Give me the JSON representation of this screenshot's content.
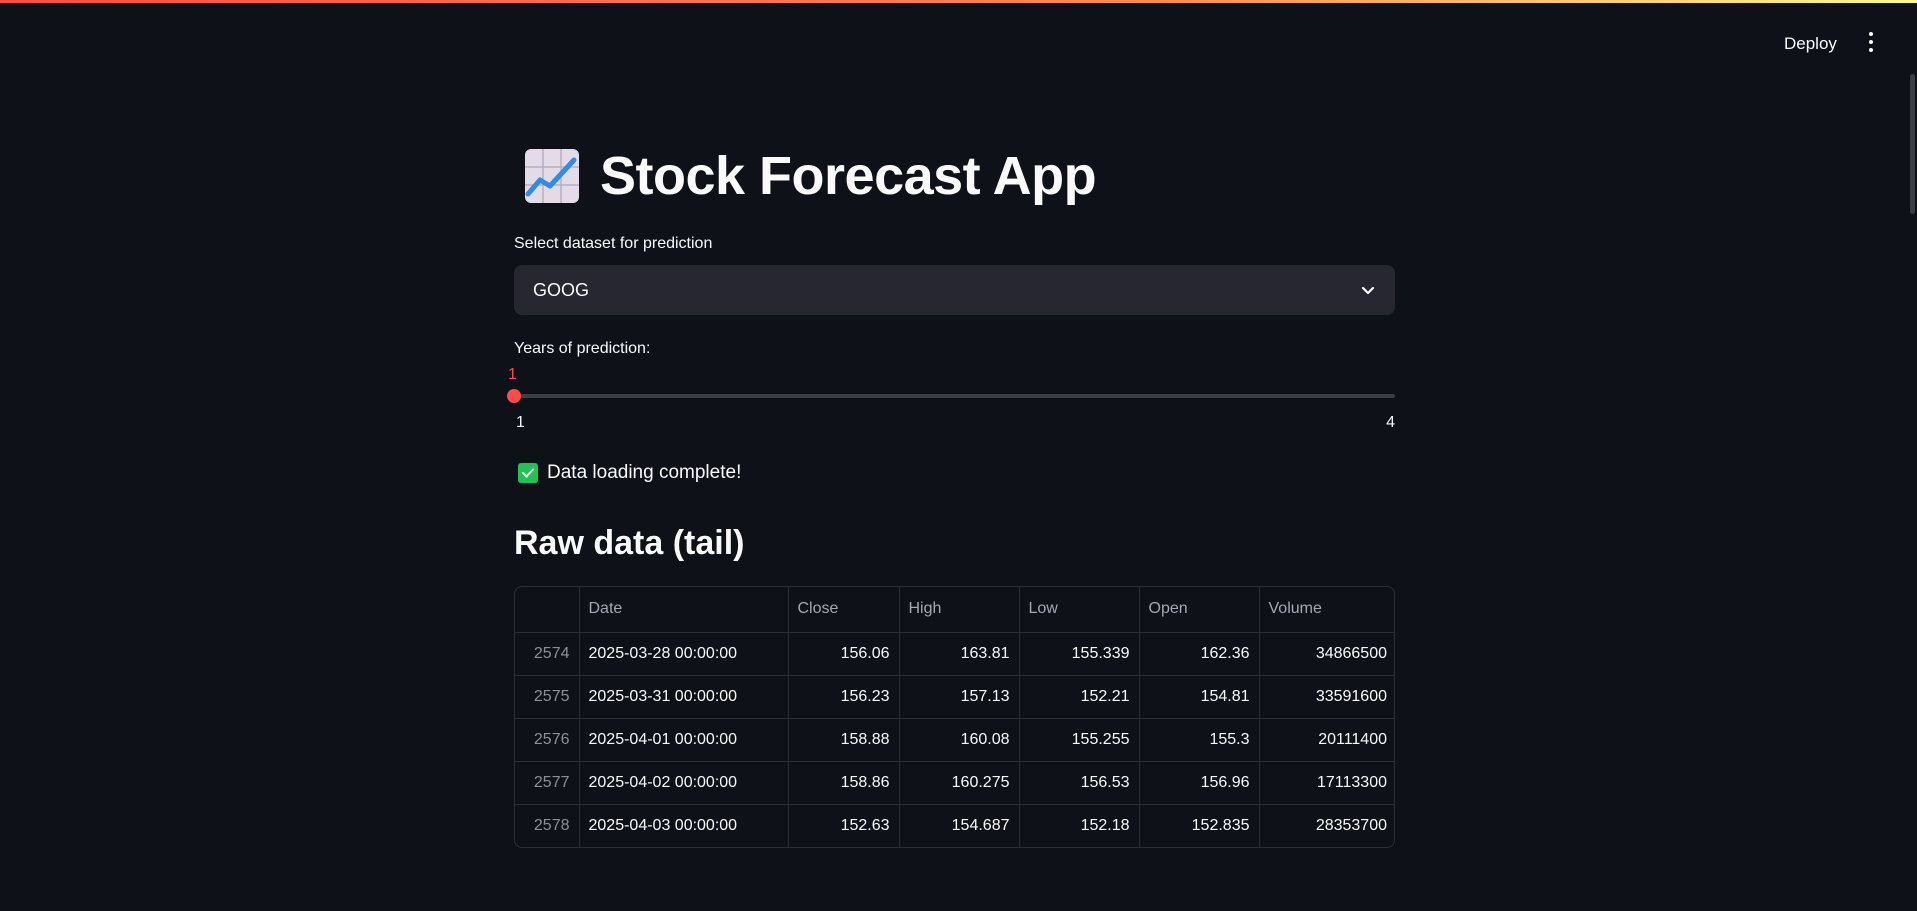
{
  "header": {
    "deploy_label": "Deploy",
    "menu_icon": "more-vertical-icon"
  },
  "app": {
    "title": "Stock Forecast App",
    "title_icon": "chart-increasing-emoji-icon"
  },
  "dataset_select": {
    "label": "Select dataset for prediction",
    "value": "GOOG",
    "icon": "chevron-down-icon"
  },
  "years_slider": {
    "label": "Years of prediction:",
    "value": 1,
    "value_label": "1",
    "min": 1,
    "max": 4,
    "min_label": "1",
    "max_label": "4"
  },
  "status": {
    "text": "Data loading complete!",
    "icon": "check-box-icon",
    "color": "#21c354"
  },
  "raw_data": {
    "heading": "Raw data (tail)",
    "columns": [
      "",
      "Date",
      "Close",
      "High",
      "Low",
      "Open",
      "Volume"
    ],
    "rows": [
      [
        "2574",
        "2025-03-28 00:00:00",
        "156.06",
        "163.81",
        "155.339",
        "162.36",
        "34866500"
      ],
      [
        "2575",
        "2025-03-31 00:00:00",
        "156.23",
        "157.13",
        "152.21",
        "154.81",
        "33591600"
      ],
      [
        "2576",
        "2025-04-01 00:00:00",
        "158.88",
        "160.08",
        "155.255",
        "155.3",
        "20111400"
      ],
      [
        "2577",
        "2025-04-02 00:00:00",
        "158.86",
        "160.275",
        "156.53",
        "156.96",
        "17113300"
      ],
      [
        "2578",
        "2025-04-03 00:00:00",
        "152.63",
        "154.687",
        "152.18",
        "152.835",
        "28353700"
      ]
    ]
  },
  "theme": {
    "background": "#0e1117",
    "accent": "#ff4b4b",
    "input_background": "#262730"
  }
}
